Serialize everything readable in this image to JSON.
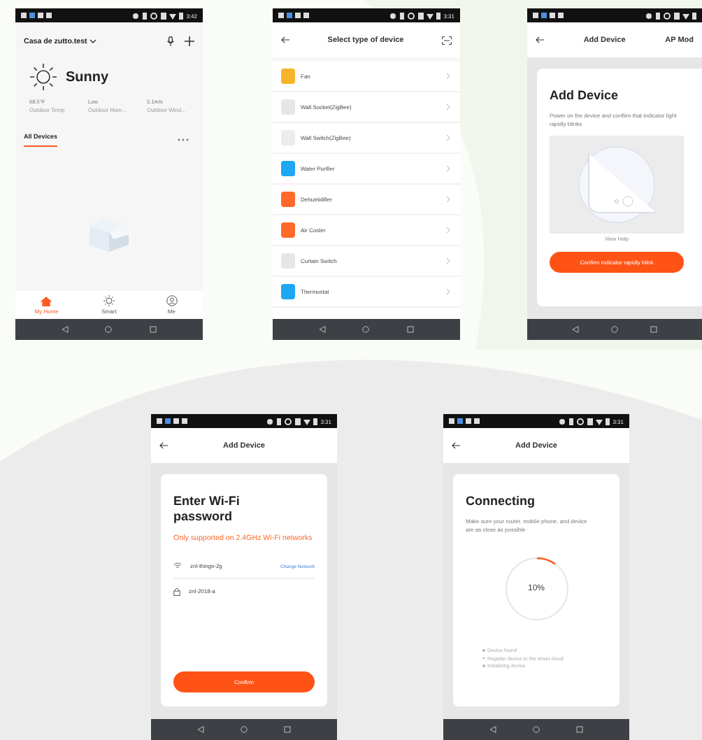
{
  "screens": [
    {
      "kind": "home",
      "status_time": "3:42",
      "home_name": "Casa de zutto.test",
      "weather": "Sunny",
      "readings": [
        {
          "value": "68.5°F",
          "label": "Outdoor Temp"
        },
        {
          "value": "Low",
          "label": "Outdoor Hum..."
        },
        {
          "value": "5.1m/s",
          "label": "Outdoor Wind..."
        }
      ],
      "section": "All Devices",
      "tabs": [
        {
          "label": "My Home",
          "selected": true
        },
        {
          "label": "Smart",
          "selected": false
        },
        {
          "label": "Me",
          "selected": false
        }
      ]
    },
    {
      "kind": "device_list",
      "status_time": "3:31",
      "title": "Select type of device",
      "items": [
        {
          "label": "Fan",
          "color": "#f7b32b"
        },
        {
          "label": "Wall Socket(ZigBee)",
          "color": "#e6e6e6"
        },
        {
          "label": "Wall Switch(ZigBee)",
          "color": "#ececec"
        },
        {
          "label": "Water Purifier",
          "color": "#1ea7f2"
        },
        {
          "label": "Dehumidifier",
          "color": "#ff6a2b"
        },
        {
          "label": "Air Cooler",
          "color": "#ff6a2b"
        },
        {
          "label": "Curtain Switch",
          "color": "#e6e6e6"
        },
        {
          "label": "Thermostat",
          "color": "#1ea7f2"
        }
      ]
    },
    {
      "kind": "add_device",
      "title": "Add Device",
      "mode": "AP Mod",
      "heading": "Add Device",
      "text": "Power on the device and confirm that indicator light rapidly blinks",
      "help": "View Help",
      "button": "Confirm indicator rapidly blink"
    },
    {
      "kind": "wifi",
      "status_time": "3:31",
      "title": "Add Device",
      "heading": "Enter Wi-Fi password",
      "warning": "Only supported on 2.4GHz Wi-Fi networks",
      "network": "znl-things-2g",
      "change": "Change Network",
      "password": "znl-2018-a",
      "button": "Confirm"
    },
    {
      "kind": "connecting",
      "status_time": "3:31",
      "title": "Add Device",
      "heading": "Connecting",
      "text": "Make sure your router, mobile phone, and device are as close as possible",
      "progress": {
        "level": 0.1,
        "reading": "10%"
      },
      "steps": [
        "Device found",
        "Register device to the smart cloud",
        "Initializing device"
      ]
    }
  ]
}
